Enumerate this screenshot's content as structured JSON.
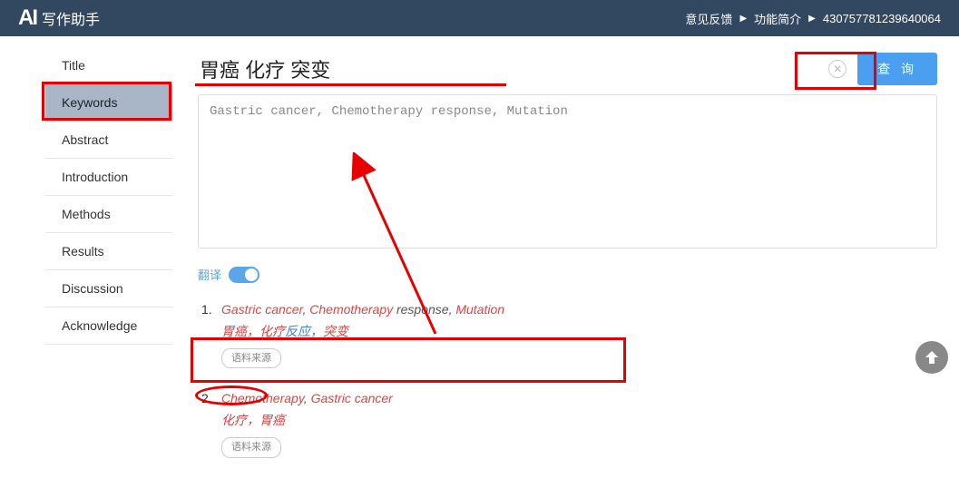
{
  "header": {
    "logo_icon": "AI",
    "logo_text": "写作助手",
    "feedback": "意见反馈",
    "intro": "功能简介",
    "userid": "430757781239640064"
  },
  "sidebar": {
    "items": [
      {
        "label": "Title"
      },
      {
        "label": "Keywords"
      },
      {
        "label": "Abstract"
      },
      {
        "label": "Introduction"
      },
      {
        "label": "Methods"
      },
      {
        "label": "Results"
      },
      {
        "label": "Discussion"
      },
      {
        "label": "Acknowledge"
      }
    ],
    "active_index": 1
  },
  "search": {
    "value": "胃癌 化疗 突变",
    "query_button": "查 询"
  },
  "textarea": {
    "value": "Gastric cancer, Chemotherapy response, Mutation"
  },
  "switch": {
    "label": "翻译",
    "on": true
  },
  "results": [
    {
      "num": "1.",
      "en_parts": [
        {
          "t": "Gastric cancer",
          "hl": true
        },
        {
          "t": ", ",
          "hl": false
        },
        {
          "t": "Chemotherapy",
          "hl": true
        },
        {
          "t": " response, ",
          "hl": false
        },
        {
          "t": "Mutation",
          "hl": true
        }
      ],
      "zh_parts": [
        {
          "t": "胃癌，化疗",
          "hl": true
        },
        {
          "t": "反应，",
          "hl": false
        },
        {
          "t": "突变",
          "hl": true
        }
      ],
      "source": "语料来源"
    },
    {
      "num": "2.",
      "en_parts": [
        {
          "t": "Chemotherapy",
          "hl": true
        },
        {
          "t": ", ",
          "hl": false
        },
        {
          "t": "Gastric cancer",
          "hl": true
        }
      ],
      "zh_parts": [
        {
          "t": "化疗，胃癌",
          "hl": true
        }
      ],
      "source": "语料来源"
    }
  ]
}
